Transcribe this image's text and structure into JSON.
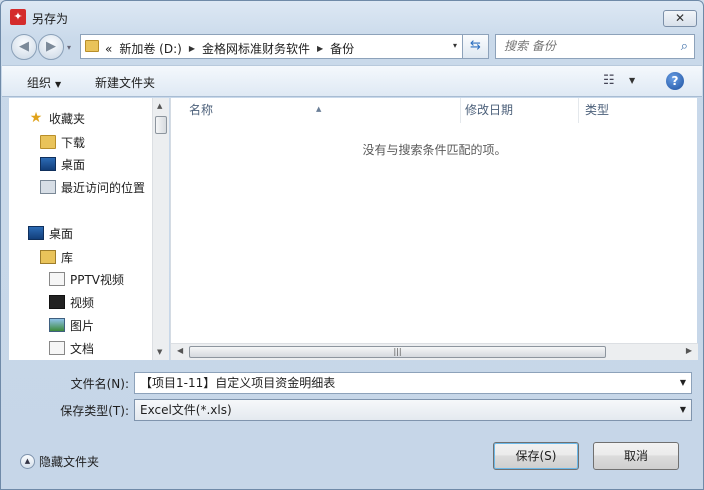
{
  "window": {
    "title": "另存为",
    "close_glyph": "✕"
  },
  "nav": {
    "back_glyph": "◀",
    "forward_glyph": "▶",
    "history_dropdown": "▾"
  },
  "address": {
    "overflow": "«",
    "crumbs": [
      "新加卷 (D:)",
      "金格网标准财务软件",
      "备份"
    ],
    "sep": "▶",
    "dropdown": "▾"
  },
  "search": {
    "placeholder": "搜索 备份",
    "icon": "⌕"
  },
  "toolbar": {
    "organize_label": "组织",
    "organize_arrow": "▼",
    "new_folder_label": "新建文件夹",
    "view_icon": "☷",
    "view_arrow": "▼",
    "help_label": "?"
  },
  "sidebar": {
    "favorites": {
      "label": "收藏夹",
      "items": [
        "下载",
        "桌面",
        "最近访问的位置"
      ]
    },
    "desktop": {
      "label": "桌面"
    },
    "libraries": {
      "label": "库",
      "items": [
        "PPTV视频",
        "视频",
        "图片",
        "文档"
      ]
    }
  },
  "filelist": {
    "columns": [
      "名称",
      "修改日期",
      "类型"
    ],
    "sort_arrow": "▲",
    "empty_message": "没有与搜索条件匹配的项。",
    "hscroll_grip": "|||"
  },
  "form": {
    "filename_label": "文件名(N):",
    "filename_value": "【项目1-11】自定义项目资金明细表",
    "filetype_label": "保存类型(T):",
    "filetype_value": "Excel文件(*.xls)"
  },
  "footer": {
    "hide_folders_label": "隐藏文件夹",
    "save_label": "保存(S)",
    "cancel_label": "取消"
  }
}
